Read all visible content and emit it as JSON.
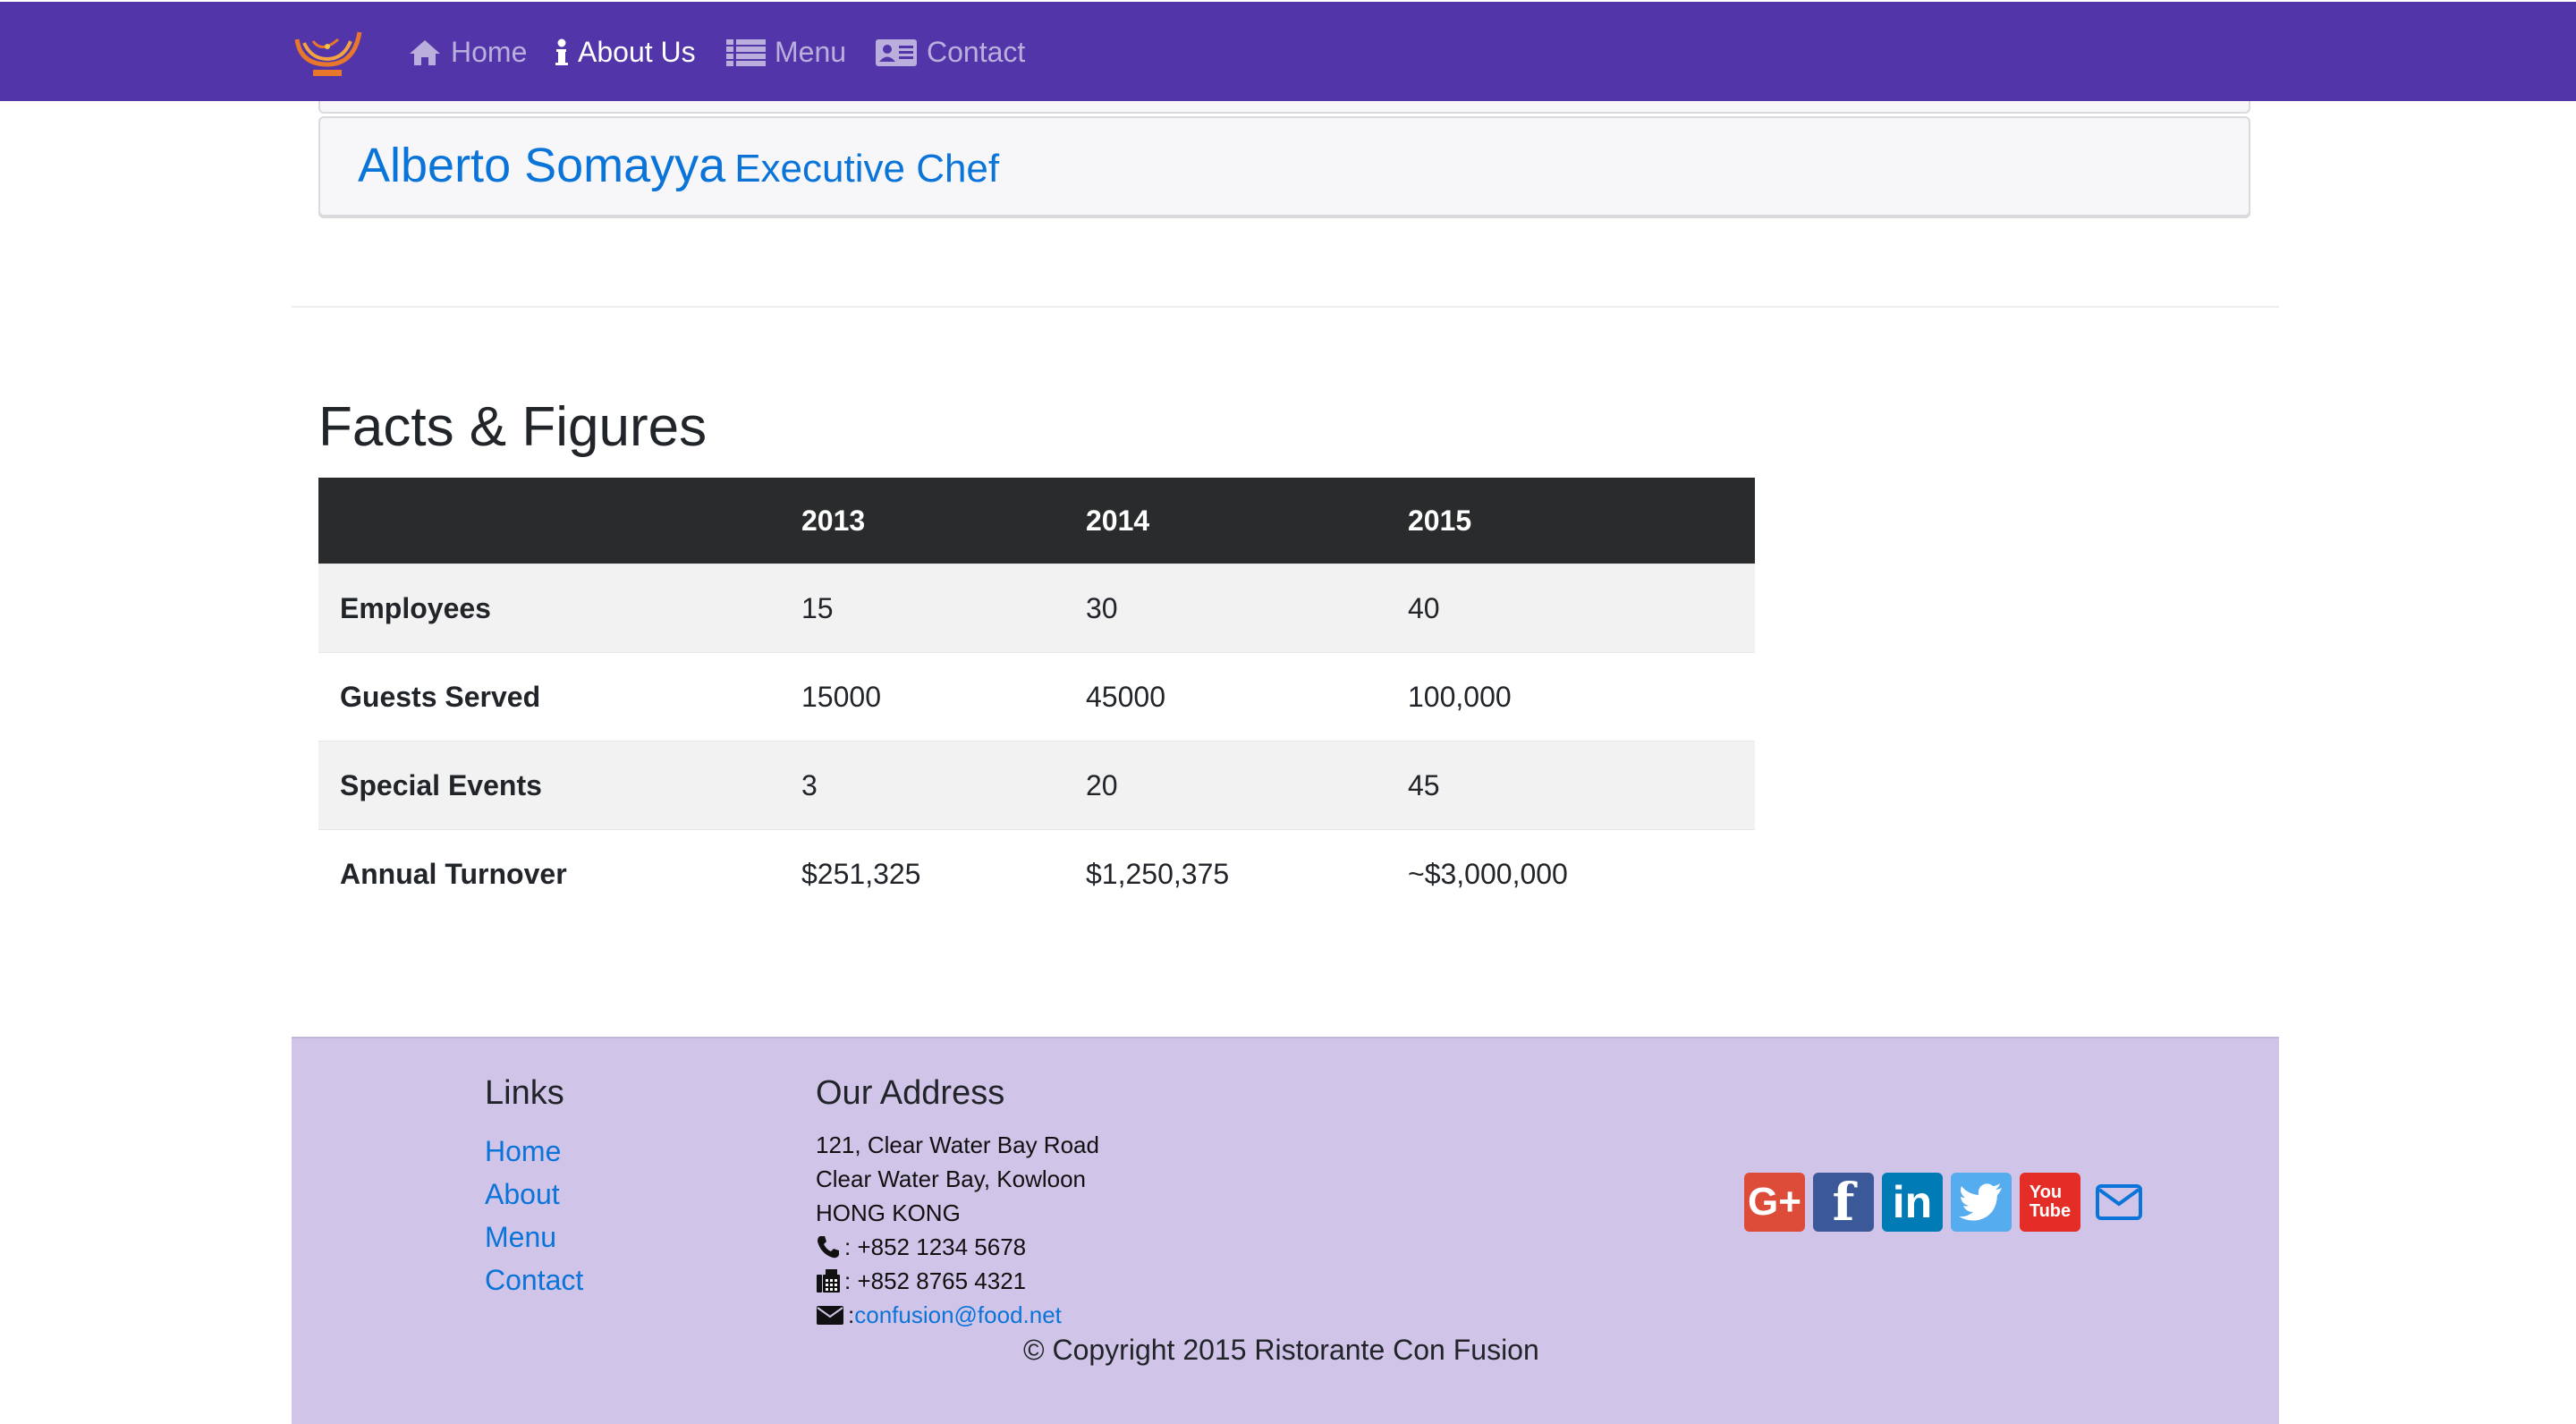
{
  "nav": {
    "logo_alt": "Ristorante Con Fusion logo",
    "items": [
      {
        "label": "Home",
        "icon": "home-icon",
        "active": false
      },
      {
        "label": "About Us",
        "icon": "info-icon",
        "active": true
      },
      {
        "label": "Menu",
        "icon": "list-icon",
        "active": false
      },
      {
        "label": "Contact",
        "icon": "address-card-icon",
        "active": false
      }
    ],
    "background": "#5235a8"
  },
  "chef": {
    "name": "Alberto Somayya",
    "title": "Executive Chef"
  },
  "facts": {
    "title": "Facts & Figures",
    "columns": [
      "",
      "2013",
      "2014",
      "2015"
    ],
    "rows": [
      {
        "label": "Employees",
        "values": [
          "15",
          "30",
          "40"
        ]
      },
      {
        "label": "Guests Served",
        "values": [
          "15000",
          "45000",
          "100,000"
        ]
      },
      {
        "label": "Special Events",
        "values": [
          "3",
          "20",
          "45"
        ]
      },
      {
        "label": "Annual Turnover",
        "values": [
          "$251,325",
          "$1,250,375",
          "~$3,000,000"
        ]
      }
    ]
  },
  "footer": {
    "links_title": "Links",
    "links": [
      "Home",
      "About",
      "Menu",
      "Contact"
    ],
    "address_title": "Our Address",
    "address_lines": [
      "121, Clear Water Bay Road",
      "Clear Water Bay, Kowloon",
      "HONG KONG"
    ],
    "phone": ": +852 1234 5678",
    "fax": ": +852 8765 4321",
    "email_prefix": ": ",
    "email": "confusion@food.net",
    "social": [
      {
        "name": "google-plus",
        "label": "G+",
        "color": "#dd4b39"
      },
      {
        "name": "facebook",
        "label": "f",
        "color": "#3b5998"
      },
      {
        "name": "linkedin",
        "label": "in",
        "color": "#007bb6"
      },
      {
        "name": "twitter",
        "label": "twitter",
        "color": "#55acee"
      },
      {
        "name": "youtube",
        "label": "You Tube",
        "color": "#e52d27"
      },
      {
        "name": "mail",
        "label": "mail",
        "color": "#0a74d8"
      }
    ],
    "copyright": "© Copyright 2015 Ristorante Con Fusion",
    "background": "#d1c4e9"
  }
}
